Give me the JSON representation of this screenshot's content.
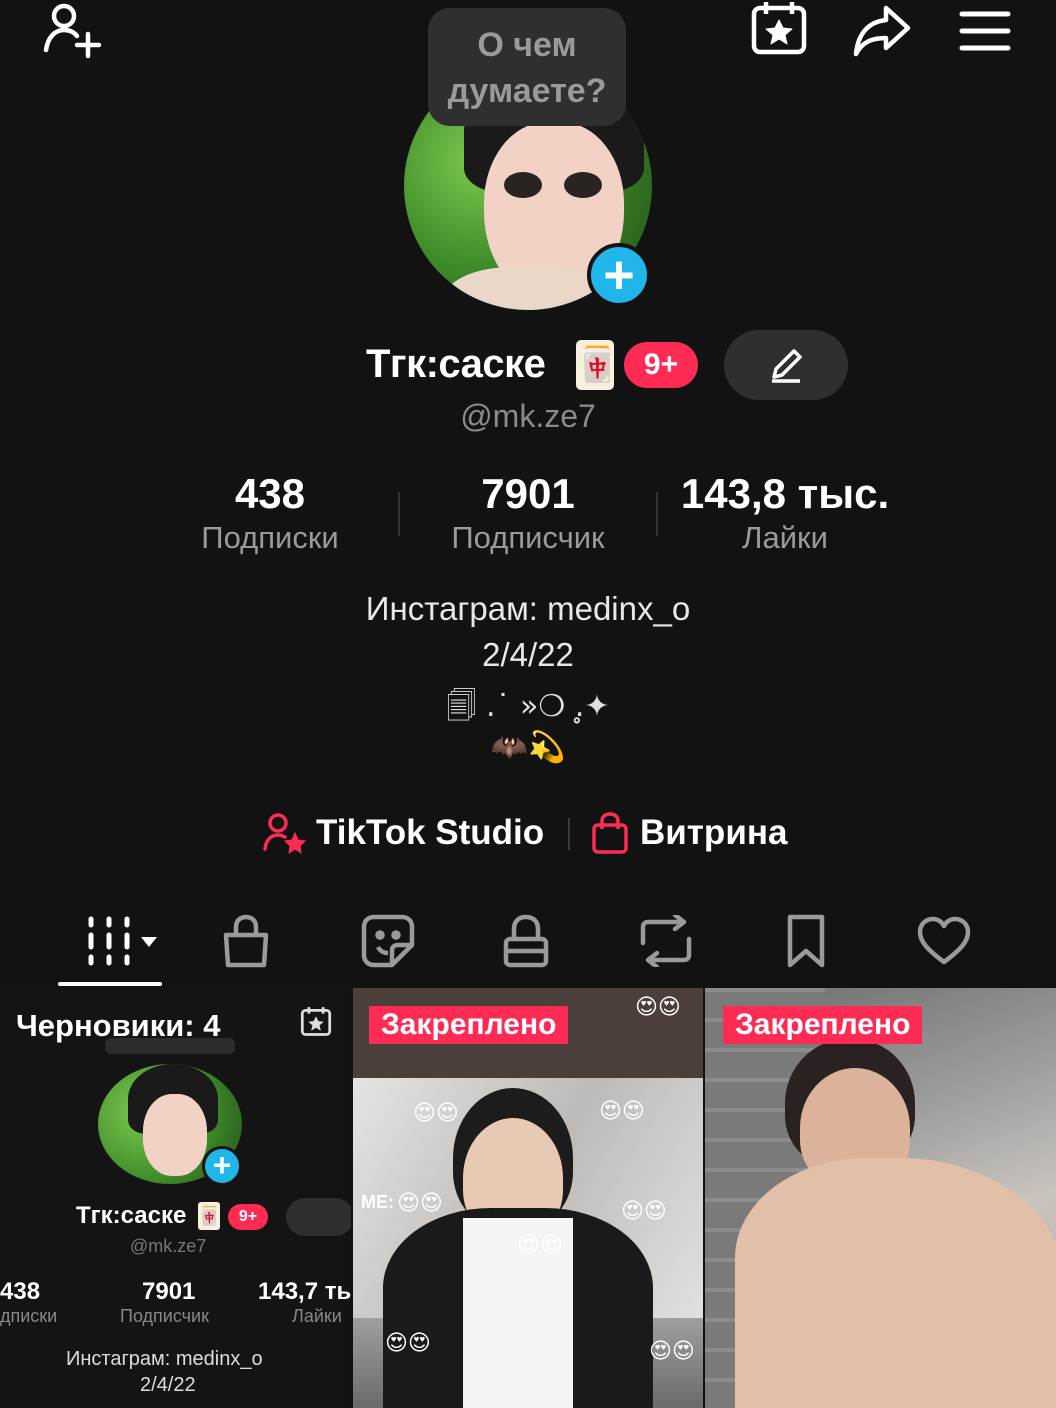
{
  "topbar": {
    "add_friend_icon": "person-plus-icon",
    "calendar_icon": "calendar-star-icon",
    "share_icon": "share-arrow-icon",
    "menu_icon": "hamburger-menu-icon"
  },
  "bubble": {
    "line1": "О чем",
    "line2": "думаете?"
  },
  "profile": {
    "name": "Тгк:саске",
    "name_emoji": "🀄",
    "badge": "9+",
    "handle": "@mk.ze7"
  },
  "stats": [
    {
      "value": "438",
      "label": "Подписки"
    },
    {
      "value": "7901",
      "label": "Подписчик"
    },
    {
      "value": "143,8 тыс.",
      "label": "Лайки"
    }
  ],
  "bio": {
    "line1": "Инстаграм: medinx_o",
    "line2": "2/4/22",
    "line3": "🗐 .˙ »❍ .̥✦",
    "line4": "🦇💫"
  },
  "links": {
    "studio": "TikTok Studio",
    "showcase": "Витрина"
  },
  "tabs": [
    "videos-grid-icon",
    "shop-bag-icon",
    "sticker-icon",
    "lock-icon",
    "repost-icon",
    "bookmark-icon",
    "heart-icon"
  ],
  "grid": {
    "drafts_label": "Черновики: 4",
    "pinned_label": "Закреплено",
    "mini_profile": {
      "name": "Тгк:саске",
      "badge": "9+",
      "handle": "@mk.ze7",
      "stat1": "438",
      "stat1_label": "дписки",
      "stat2": "7901",
      "stat2_label": "Подписчик",
      "stat3": "143,7 ты",
      "stat3_label": "Лайки",
      "bio1": "Инстаграм: medinx_o",
      "bio2": "2/4/22"
    },
    "overlay_text": "ME:"
  },
  "colors": {
    "background": "#121212",
    "accent": "#fe2c55",
    "plus_blue": "#20b6e9"
  }
}
